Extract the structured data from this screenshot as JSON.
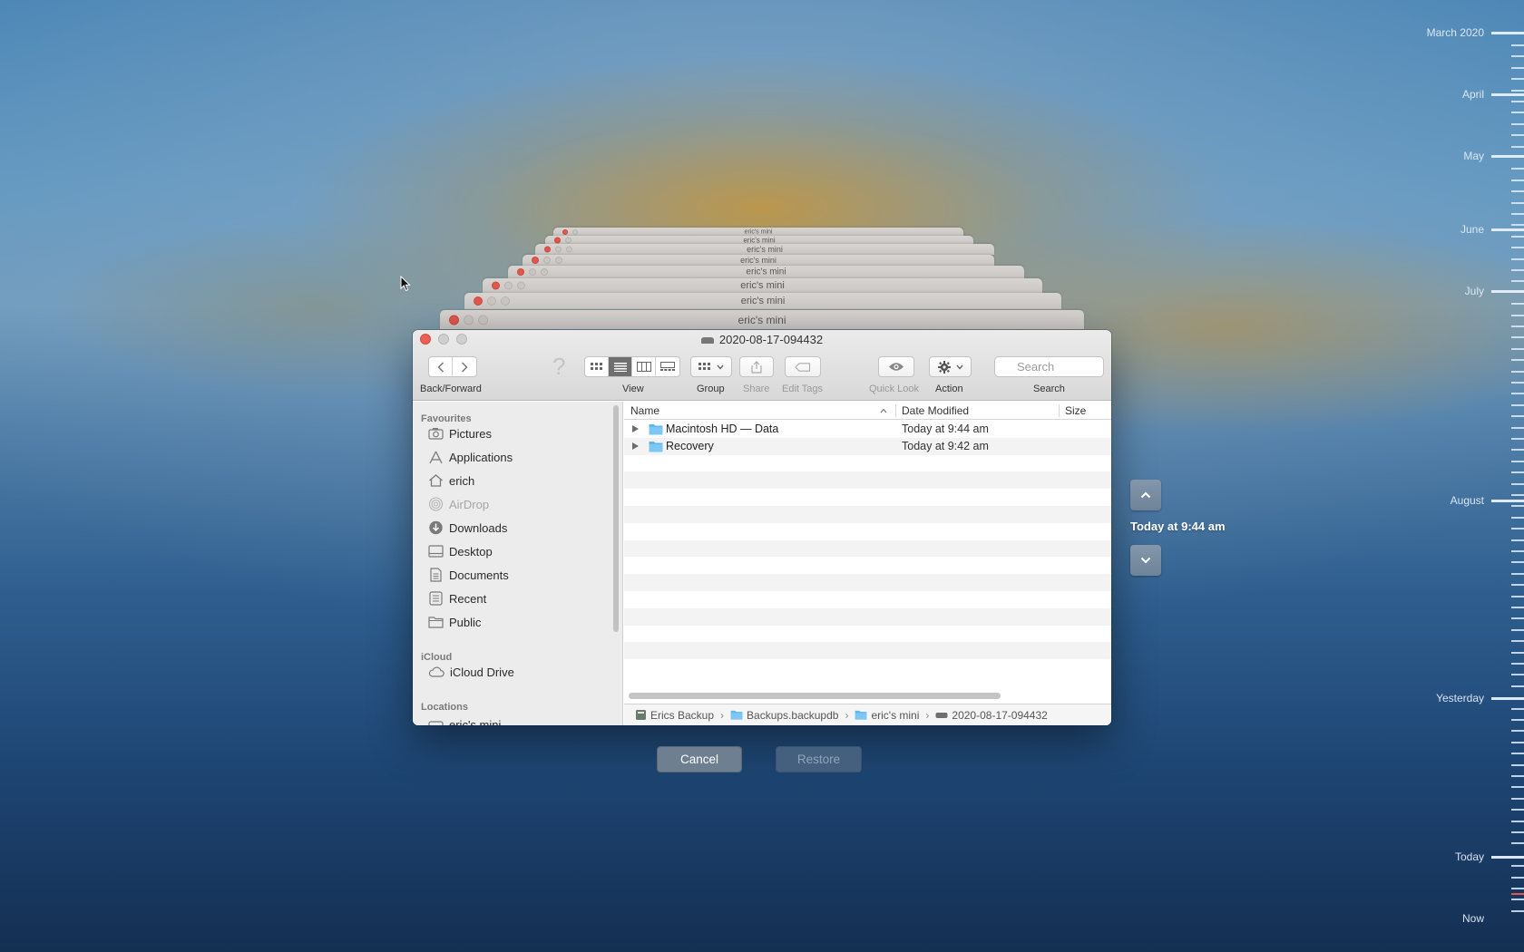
{
  "stack": {
    "titles": [
      "eric's mini",
      "eric's mini",
      "eric's mini",
      "eric's mini",
      "eric's mini",
      "eric's mini",
      "eric's mini",
      "eric's mini",
      "eric's mini"
    ]
  },
  "window": {
    "title": "2020-08-17-094432"
  },
  "toolbar": {
    "back_forward_label": "Back/Forward",
    "view_label": "View",
    "group_label": "Group",
    "share_label": "Share",
    "edit_tags_label": "Edit Tags",
    "quick_look_label": "Quick Look",
    "action_label": "Action",
    "search_label": "Search",
    "search_placeholder": "Search"
  },
  "sidebar": {
    "favourites_heading": "Favourites",
    "favourites": [
      {
        "label": "Pictures",
        "icon": "camera-icon"
      },
      {
        "label": "Applications",
        "icon": "applications-icon"
      },
      {
        "label": "erich",
        "icon": "home-icon"
      },
      {
        "label": "AirDrop",
        "icon": "airdrop-icon"
      },
      {
        "label": "Downloads",
        "icon": "download-icon"
      },
      {
        "label": "Desktop",
        "icon": "desktop-icon"
      },
      {
        "label": "Documents",
        "icon": "document-icon"
      },
      {
        "label": "Recent",
        "icon": "clock-icon"
      },
      {
        "label": "Public",
        "icon": "folder-icon"
      }
    ],
    "icloud_heading": "iCloud",
    "icloud": [
      {
        "label": "iCloud Drive",
        "icon": "cloud-icon"
      }
    ],
    "locations_heading": "Locations",
    "locations": [
      {
        "label": "eric's mini",
        "icon": "disk-icon"
      }
    ]
  },
  "list": {
    "columns": {
      "name": "Name",
      "date": "Date Modified",
      "size": "Size"
    },
    "rows": [
      {
        "name": "Macintosh HD — Data",
        "date": "Today at 9:44 am"
      },
      {
        "name": "Recovery",
        "date": "Today at 9:42 am"
      }
    ]
  },
  "pathbar": {
    "items": [
      "Erics Backup",
      "Backups.backupdb",
      "eric's mini",
      "2020-08-17-094432"
    ]
  },
  "buttons": {
    "cancel": "Cancel",
    "restore": "Restore"
  },
  "navigation": {
    "current_time": "Today at 9:44 am"
  },
  "timeline": {
    "labels": [
      "March 2020",
      "April",
      "May",
      "June",
      "July",
      "August",
      "Yesterday",
      "Today",
      "Now"
    ],
    "current_marker_color": "#e0574c"
  },
  "colors": {
    "accent": "#6f6f6f",
    "folder_blue": "#5fb7ee",
    "close_red": "#ec5f57"
  }
}
